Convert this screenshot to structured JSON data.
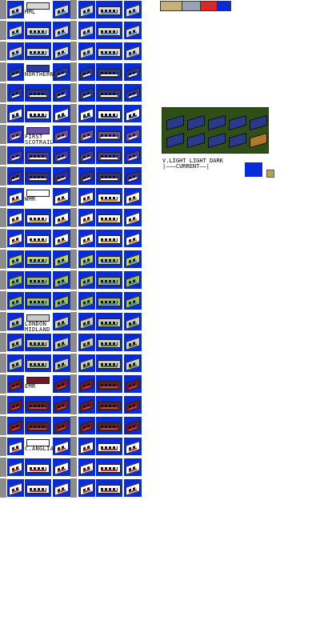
{
  "colors": {
    "tile_bg": "#0a2bd8",
    "panel_bg": "#2f4f17",
    "separator": "#8c8c8c"
  },
  "liveries": [
    {
      "label": "MML",
      "body": "#d9d9d9",
      "stripe": "#3a7bd5",
      "row": 0
    },
    {
      "label": "",
      "body": "#d9d9d9",
      "stripe": "#3a7bd5",
      "row": 1
    },
    {
      "label": "",
      "body": "#d9d9d9",
      "stripe": "#3a7bd5",
      "row": 2
    },
    {
      "label": "NORTHERN",
      "body": "#2a3a9a",
      "stripe": "#ffffff",
      "row": 3
    },
    {
      "label": "",
      "body": "#2a3a9a",
      "stripe": "#ffffff",
      "row": 4
    },
    {
      "label": "",
      "body": "#ffffff",
      "stripe": "#1b2e85",
      "row": 5
    },
    {
      "label": "FIRST\nSCOTRAIL",
      "body": "#6a4ea8",
      "stripe": "#ffffff",
      "row": 6
    },
    {
      "label": "",
      "body": "#4a3aa0",
      "stripe": "#ffffff",
      "row": 7
    },
    {
      "label": "",
      "body": "#3a2e8a",
      "stripe": "#ffffff",
      "row": 8
    },
    {
      "label": "WMR",
      "body": "#ffffff",
      "stripe": "#c2701f",
      "row": 9
    },
    {
      "label": "",
      "body": "#ffffff",
      "stripe": "#c2701f",
      "row": 10
    },
    {
      "label": "",
      "body": "#ffffff",
      "stripe": "#c2701f",
      "row": 11
    },
    {
      "label": "",
      "body": "#b9d36a",
      "stripe": "#3a7bd5",
      "row": 12
    },
    {
      "label": "",
      "body": "#9ac060",
      "stripe": "#3a7bd5",
      "row": 13
    },
    {
      "label": "",
      "body": "#9ac060",
      "stripe": "#3a7bd5",
      "row": 14
    },
    {
      "label": "LONDON\nMIDLAND",
      "body": "#c9c9c9",
      "stripe": "#3f6f1f",
      "row": 15
    },
    {
      "label": "",
      "body": "#c9c9c9",
      "stripe": "#3f6f1f",
      "row": 16
    },
    {
      "label": "",
      "body": "#c9c9c9",
      "stripe": "#3f6f1f",
      "row": 17
    },
    {
      "label": "EMR",
      "body": "#6b1a2a",
      "stripe": "#c84040",
      "row": 18
    },
    {
      "label": "",
      "body": "#6b1a2a",
      "stripe": "#c84040",
      "row": 19
    },
    {
      "label": "",
      "body": "#6b1a2a",
      "stripe": "#c84040",
      "row": 20
    },
    {
      "label": "C.ANGLIA",
      "body": "#ffffff",
      "stripe": "#c83030",
      "row": 21
    },
    {
      "label": "",
      "body": "#ffffff",
      "stripe": "#c83030",
      "row": 22
    },
    {
      "label": "",
      "body": "#ffffff",
      "stripe": "#c83030",
      "row": 23
    }
  ],
  "legend": {
    "v_light": "V.LIGHT",
    "light": "LIGHT",
    "dark": "DARK",
    "current": "CURRENT"
  }
}
